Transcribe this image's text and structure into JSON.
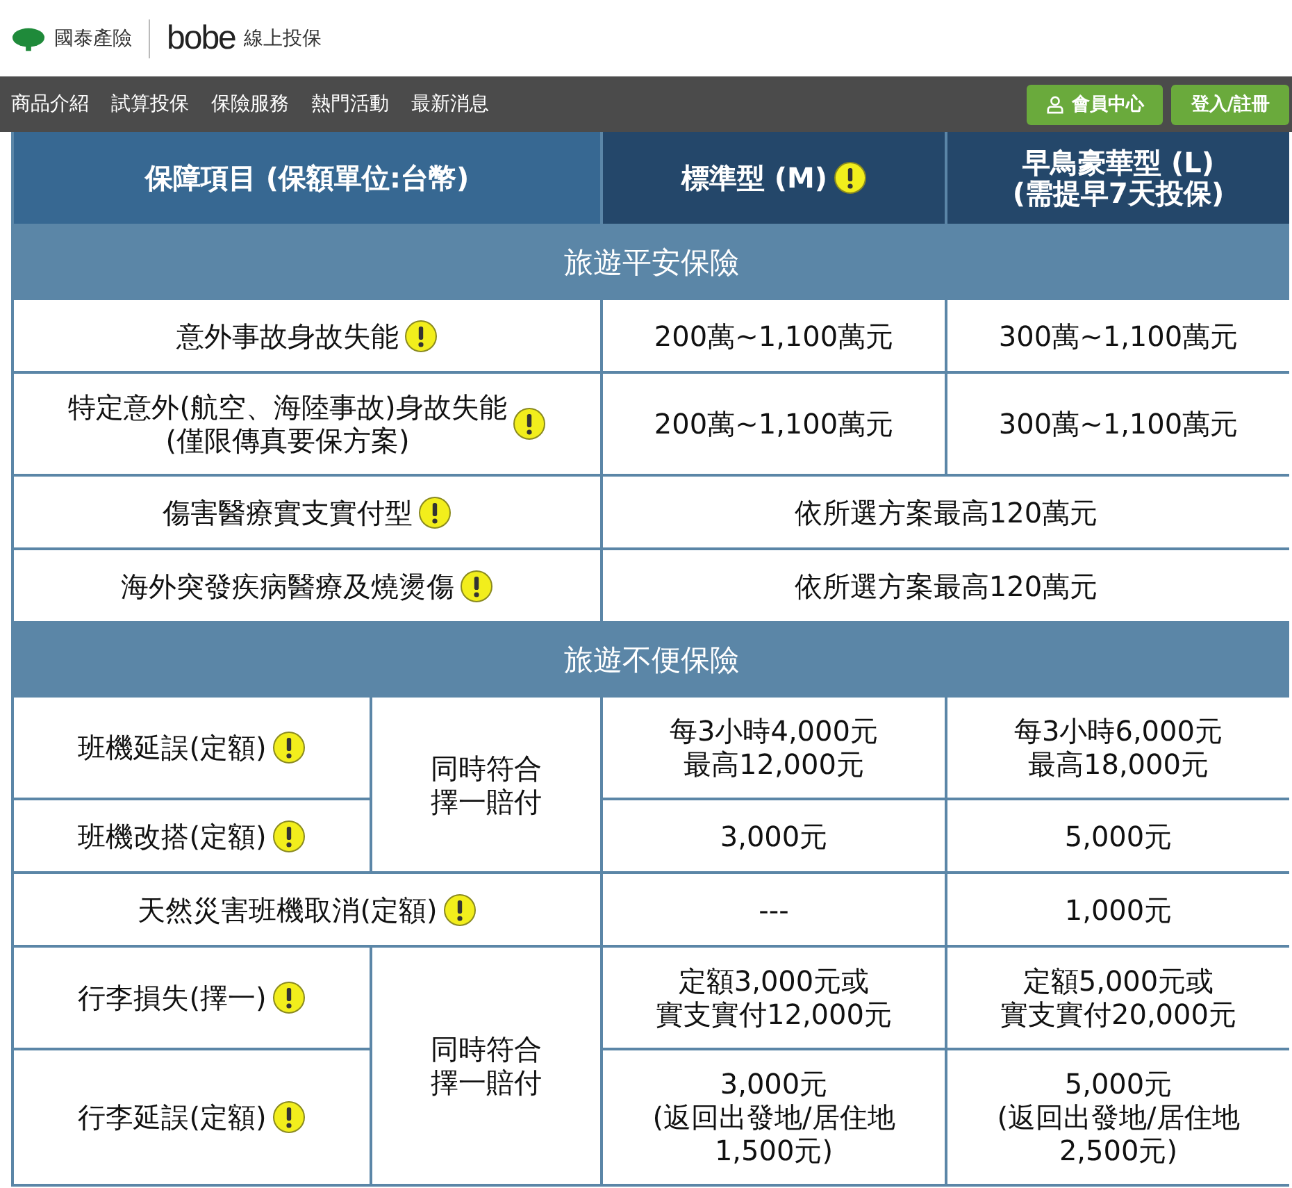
{
  "brand": {
    "company": "國泰產險",
    "product_logo": "bobe",
    "product": "線上投保"
  },
  "nav": {
    "items": [
      "商品介紹",
      "試算投保",
      "保險服務",
      "熱門活動",
      "最新消息"
    ],
    "buttons": [
      {
        "label": "會員中心",
        "icon": true
      },
      {
        "label": "登入/註冊",
        "icon": false
      }
    ]
  },
  "table": {
    "columns": [
      {
        "lines": [
          "保障項目 (保額單位:台幣)"
        ],
        "info": false
      },
      {
        "lines": [
          "標準型 (M)"
        ],
        "info": true
      },
      {
        "lines": [
          "早鳥豪華型 (L)",
          "(需提早7天投保)"
        ],
        "info": false
      }
    ],
    "sections": [
      {
        "title": "旅遊平安保險",
        "rows": [
          {
            "kind": "split",
            "label": [
              "意外事故身故失能"
            ],
            "values": [
              [
                "200萬~1,100萬元"
              ],
              [
                "300萬~1,100萬元"
              ]
            ]
          },
          {
            "kind": "split",
            "label": [
              "特定意外(航空、海陸事故)身故失能",
              "(僅限傳真要保方案)"
            ],
            "values": [
              [
                "200萬~1,100萬元"
              ],
              [
                "300萬~1,100萬元"
              ]
            ]
          },
          {
            "kind": "span",
            "label": [
              "傷害醫療實支實付型"
            ],
            "value": [
              "依所選方案最高120萬元"
            ]
          },
          {
            "kind": "span",
            "label": [
              "海外突發疾病醫療及燒燙傷"
            ],
            "value": [
              "依所選方案最高120萬元"
            ]
          }
        ]
      },
      {
        "title": "旅遊不便保險",
        "rows": [
          {
            "kind": "group",
            "note": [
              "同時符合",
              "擇一賠付"
            ],
            "items": [
              {
                "label": [
                  "班機延誤(定額)"
                ],
                "values": [
                  [
                    "每3小時4,000元",
                    "最高12,000元"
                  ],
                  [
                    "每3小時6,000元",
                    "最高18,000元"
                  ]
                ]
              },
              {
                "label": [
                  "班機改搭(定額)"
                ],
                "values": [
                  [
                    "3,000元"
                  ],
                  [
                    "5,000元"
                  ]
                ]
              }
            ]
          },
          {
            "kind": "split",
            "label": [
              "天然災害班機取消(定額)"
            ],
            "values": [
              [
                "---"
              ],
              [
                "1,000元"
              ]
            ]
          },
          {
            "kind": "group",
            "note": [
              "同時符合",
              "擇一賠付"
            ],
            "items": [
              {
                "label": [
                  "行李損失(擇一)"
                ],
                "values": [
                  [
                    "定額3,000元或",
                    "實支實付12,000元"
                  ],
                  [
                    "定額5,000元或",
                    "實支實付20,000元"
                  ]
                ]
              },
              {
                "label": [
                  "行李延誤(定額)"
                ],
                "values": [
                  [
                    "3,000元",
                    "(返回出發地/居住地",
                    "1,500元)"
                  ],
                  [
                    "5,000元",
                    "(返回出發地/居住地",
                    "2,500元)"
                  ]
                ]
              }
            ]
          }
        ]
      }
    ]
  }
}
